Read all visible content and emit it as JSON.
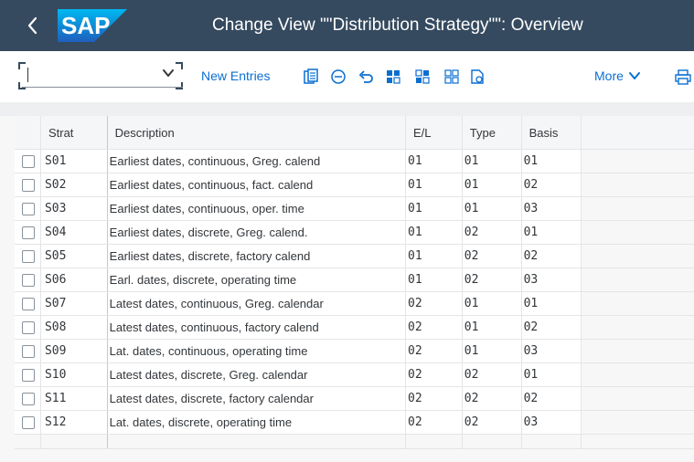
{
  "shell": {
    "title": "Change View \"\"Distribution Strategy\"\": Overview",
    "logo_text": "SAP",
    "back_icon": "chevron-left-icon"
  },
  "toolbar": {
    "dropdown_value": "",
    "new_entries_label": "New Entries",
    "more_label": "More",
    "icons": [
      "copy-icon",
      "remove-icon",
      "undo-icon",
      "select-all-icon",
      "select-block-icon",
      "deselect-all-icon",
      "details-icon",
      "print-icon"
    ]
  },
  "table": {
    "columns": [
      "Strat",
      "Description",
      "E/L",
      "Type",
      "Basis"
    ],
    "rows": [
      {
        "strat": "S01",
        "description": "Earliest dates, continuous, Greg. calend",
        "el": "01",
        "type": "01",
        "basis": "01"
      },
      {
        "strat": "S02",
        "description": "Earliest dates, continuous, fact. calend",
        "el": "01",
        "type": "01",
        "basis": "02"
      },
      {
        "strat": "S03",
        "description": "Earliest dates, continuous, oper. time",
        "el": "01",
        "type": "01",
        "basis": "03"
      },
      {
        "strat": "S04",
        "description": "Earliest dates, discrete, Greg. calend.",
        "el": "01",
        "type": "02",
        "basis": "01"
      },
      {
        "strat": "S05",
        "description": "Earliest dates, discrete, factory calend",
        "el": "01",
        "type": "02",
        "basis": "02"
      },
      {
        "strat": "S06",
        "description": "Earl. dates, discrete, operating time",
        "el": "01",
        "type": "02",
        "basis": "03"
      },
      {
        "strat": "S07",
        "description": "Latest dates, continuous, Greg. calendar",
        "el": "02",
        "type": "01",
        "basis": "01"
      },
      {
        "strat": "S08",
        "description": "Latest dates, continuous, factory calend",
        "el": "02",
        "type": "01",
        "basis": "02"
      },
      {
        "strat": "S09",
        "description": "Lat. dates, continuous, operating time",
        "el": "02",
        "type": "01",
        "basis": "03"
      },
      {
        "strat": "S10",
        "description": "Latest dates, discrete, Greg. calendar",
        "el": "02",
        "type": "02",
        "basis": "01"
      },
      {
        "strat": "S11",
        "description": "Latest dates, discrete, factory calendar",
        "el": "02",
        "type": "02",
        "basis": "02"
      },
      {
        "strat": "S12",
        "description": "Lat. dates, discrete, operating time",
        "el": "02",
        "type": "02",
        "basis": "03"
      }
    ]
  },
  "colors": {
    "shell_bg": "#354a5f",
    "link_blue": "#0a6ed1",
    "logo_blue": "#0a6ed1"
  }
}
